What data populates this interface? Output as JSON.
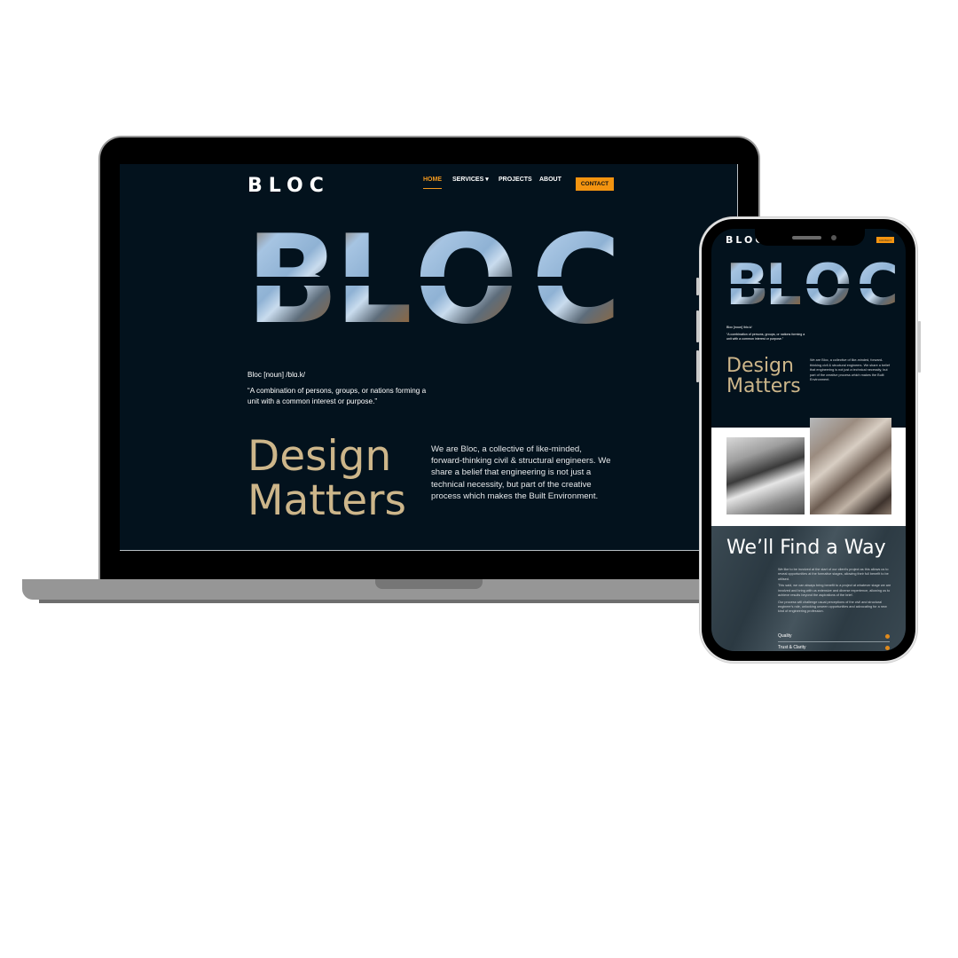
{
  "brand": {
    "logo": "BLOC",
    "hero_letters": [
      "B",
      "L",
      "O",
      "C"
    ],
    "accent": "#f39410",
    "gold": "#cdb68a",
    "background": "#03121d"
  },
  "nav": {
    "items": [
      {
        "label": "HOME",
        "active": true
      },
      {
        "label": "SERVICES",
        "has_dropdown": true,
        "caret": "▾"
      },
      {
        "label": "PROJECTS"
      },
      {
        "label": "ABOUT"
      }
    ],
    "contact_label": "CONTACT"
  },
  "definition": {
    "title": "Bloc [noun] /blɑ.k/",
    "quote": "“A combination of persons, groups, or nations forming a unit with a common interest or purpose.”"
  },
  "intro": {
    "heading_line1": "Design",
    "heading_line2": "Matters",
    "body": "We are Bloc, a collective of like-minded, forward-thinking civil & structural engineers. We share a belief that engineering is not just a technical necessity, but part of the creative process which makes the Built Environment."
  },
  "approach": {
    "heading": "We’ll Find a Way",
    "paragraphs": [
      "We like to be involved at the start of our client's project as this allows us to reveal opportunities at the formative stages, allowing their full benefit to be utilised.",
      "This said, we can always bring benefit to a project at whatever stage we are involved and bring with us extensive and diverse experience, allowing us to achieve results beyond the aspirations of the brief.",
      "Our process will challenge usual perceptions of the civil and structural engineer's role, unlocking unseen opportunities and advocating for a new kind of engineering profession."
    ],
    "accordion": [
      {
        "label": "Quality",
        "icon": "plus-circle-icon"
      },
      {
        "label": "Trust & Clarity",
        "icon": "plus-circle-icon"
      }
    ]
  },
  "images": {
    "phone_img1": "engineer-on-site-photo",
    "phone_img2": "curved-structure-photo"
  }
}
